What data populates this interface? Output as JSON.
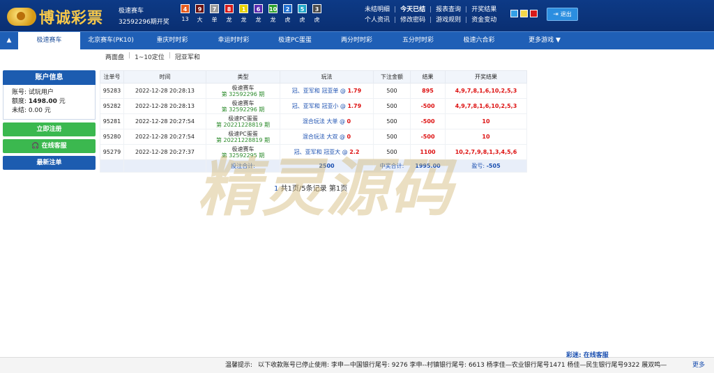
{
  "header": {
    "site_name": "博诚彩票",
    "game_name": "极速赛车",
    "issue_text": "32592296期开奖",
    "balls": [
      {
        "num": "4",
        "attr": "13",
        "color": "#e55a1c"
      },
      {
        "num": "9",
        "attr": "大",
        "color": "#6a1010"
      },
      {
        "num": "7",
        "attr": "单",
        "color": "#9a9a9a"
      },
      {
        "num": "8",
        "attr": "龙",
        "color": "#d41a1a"
      },
      {
        "num": "1",
        "attr": "龙",
        "color": "#e6d200"
      },
      {
        "num": "6",
        "attr": "龙",
        "color": "#5a2ab0"
      },
      {
        "num": "10",
        "attr": "龙",
        "color": "#2aa02a"
      },
      {
        "num": "2",
        "attr": "虎",
        "color": "#1e6fd0"
      },
      {
        "num": "5",
        "attr": "虎",
        "color": "#1fa7c9"
      },
      {
        "num": "3",
        "attr": "虎",
        "color": "#4a4a4a"
      }
    ],
    "links_row1": [
      "未结明细",
      "今天已结",
      "报表查询",
      "开奖结果"
    ],
    "links_row2": [
      "个人资讯",
      "修改密码",
      "游戏规则",
      "资金变动"
    ],
    "theme_colors": [
      "#33a0e6",
      "#f2d64b",
      "#d81a1a"
    ],
    "logout_label": "退出",
    "logout_icon": "exit-icon"
  },
  "nav": {
    "toggle_icon": "▲",
    "tabs": [
      "极速赛车",
      "北京赛车(PK10)",
      "重庆时时彩",
      "幸运时时彩",
      "极速PC蛋蛋",
      "两分时时彩",
      "五分时时彩",
      "极速六合彩",
      "更多游戏  ▼"
    ]
  },
  "subnav": [
    "两面盘",
    "1~10定位",
    "冠亚军和"
  ],
  "sidebar": {
    "account_title": "账户信息",
    "account_label": "账号:",
    "account_value": "试玩用户",
    "quota_label": "额度:",
    "quota_value": "1498.00",
    "quota_unit": "元",
    "unsettled_label": "未结:",
    "unsettled_value": "0.00 元",
    "register_label": "立即注册",
    "service_label": "在线客服",
    "service_icon": "headset-icon",
    "latest_label": "最新注单"
  },
  "table": {
    "headers": [
      "注单号",
      "时间",
      "类型",
      "玩法",
      "下注金额",
      "结果",
      "开奖结果"
    ],
    "rows": [
      {
        "id": "95283",
        "time": "2022-12-28 20:28:13",
        "type": "极速赛车",
        "issue": "第 32592296 期",
        "play": "冠、亚军和 冠亚单 @",
        "odds": "1.79",
        "amount": "500",
        "result": "895",
        "draw": "4,9,7,8,1,6,10,2,5,3"
      },
      {
        "id": "95282",
        "time": "2022-12-28 20:28:13",
        "type": "极速赛车",
        "issue": "第 32592296 期",
        "play": "冠、亚军和 冠亚小 @",
        "odds": "1.79",
        "amount": "500",
        "result": "-500",
        "draw": "4,9,7,8,1,6,10,2,5,3"
      },
      {
        "id": "95281",
        "time": "2022-12-28 20:27:54",
        "type": "极速PC蛋蛋",
        "issue": "第 20221228819 期",
        "play": "混合玩法 大单 @",
        "odds": "0",
        "amount": "500",
        "result": "-500",
        "draw": "10"
      },
      {
        "id": "95280",
        "time": "2022-12-28 20:27:54",
        "type": "极速PC蛋蛋",
        "issue": "第 20221228819 期",
        "play": "混合玩法 大双 @",
        "odds": "0",
        "amount": "500",
        "result": "-500",
        "draw": "10"
      },
      {
        "id": "95279",
        "time": "2022-12-28 20:27:37",
        "type": "极速赛车",
        "issue": "第 32592295 期",
        "play": "冠、亚军和 冠亚大 @",
        "odds": "2.2",
        "amount": "500",
        "result": "1100",
        "draw": "10,2,7,9,8,1,3,4,5,6"
      }
    ],
    "summary": {
      "bet_label": "投注合计:",
      "bet_total": "2500",
      "win_label": "中奖合计:",
      "win_total": "1995.00",
      "profit_label": "盈亏:",
      "profit_total": "-505"
    }
  },
  "pager": {
    "current": "1",
    "text": "共1页/5条记录 第1页"
  },
  "watermark": "精灵源码",
  "footer": {
    "label": "温馨提示:",
    "text": "以下收款账号已停止使用: 李申—中国银行尾号: 9276 李申--村镇银行尾号: 6613 杨李佳—农业银行尾号1471 杨佳—民生银行尾号9322 展双鸣—",
    "overlay": "彩迷: 在线客服",
    "more": "更多"
  }
}
